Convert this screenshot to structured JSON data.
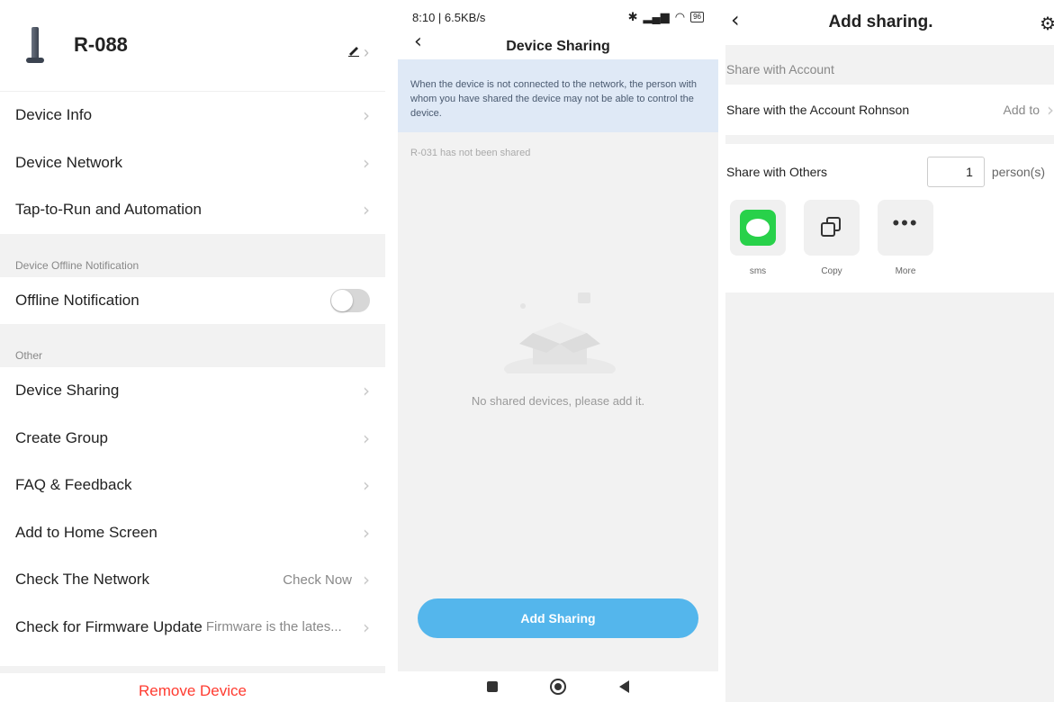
{
  "panel1": {
    "device_name": "R-088",
    "rows_top": [
      {
        "label": "Device Info"
      },
      {
        "label": "Device Network"
      },
      {
        "label": "Tap-to-Run and Automation"
      }
    ],
    "section_offline": "Device Offline Notification",
    "offline_label": "Offline Notification",
    "section_other": "Other",
    "rows_other": [
      {
        "label": "Device Sharing"
      },
      {
        "label": "Create Group"
      },
      {
        "label": "FAQ & Feedback"
      },
      {
        "label": "Add to Home Screen"
      }
    ],
    "check_network": {
      "label": "Check The Network",
      "value": "Check Now"
    },
    "firmware": {
      "label": "Check for Firmware Update",
      "value": "Firmware is the lates..."
    },
    "remove_label": "Remove Device"
  },
  "panel2": {
    "status_left": "8:10 | 6.5KB/s",
    "battery": "96",
    "title": "Device Sharing",
    "notice": "When the device is not connected to the network, the person with whom you have shared the device may not be able to control the device.",
    "not_shared": "R-031 has not been shared",
    "empty_text": "No shared devices, please add it.",
    "add_button": "Add Sharing"
  },
  "panel3": {
    "title": "Add sharing.",
    "section_account": "Share with Account",
    "account_row": "Share with the Account Rohnson",
    "add_to": "Add to",
    "share_others": "Share with Others",
    "qty": "1",
    "persons": "person(s)",
    "apps": [
      {
        "label": "sms"
      },
      {
        "label": "Copy"
      },
      {
        "label": "More"
      }
    ]
  }
}
